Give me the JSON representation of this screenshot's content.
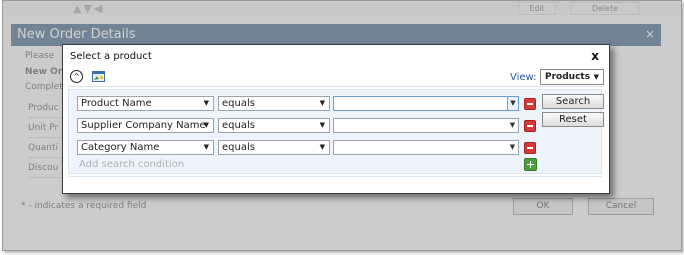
{
  "background": {
    "toolbar": {
      "edit_label": "Edit",
      "delete_label": "Delete"
    },
    "title": "New Order Details",
    "close_glyph": "×",
    "intro_text": "Please",
    "subheading": "New Or",
    "completed_text": "Complete",
    "fields": [
      "Produc",
      "Unit Pr",
      "Quanti",
      "Discou"
    ],
    "required_note": "* - indicates a required field",
    "ok_label": "OK",
    "cancel_label": "Cancel"
  },
  "dialog": {
    "title": "Select a product",
    "close_glyph": "x",
    "collapse_glyph": "^",
    "view_label": "View:",
    "view_value": "Products",
    "conditions": [
      {
        "field": "Product Name",
        "operator": "equals",
        "value": ""
      },
      {
        "field": "Supplier Company Name",
        "operator": "equals",
        "value": ""
      },
      {
        "field": "Category Name",
        "operator": "equals",
        "value": ""
      }
    ],
    "add_condition_label": "Add search condition",
    "search_label": "Search",
    "reset_label": "Reset"
  },
  "colors": {
    "header_bg": "#5e7c9c",
    "filter_bg": "#eef4fb",
    "remove_red": "#d33b3b",
    "add_green": "#4f9e3c",
    "view_label": "#2a5a9a"
  },
  "icons": [
    "collapse-icon",
    "image-icon",
    "remove-icon",
    "add-icon",
    "dropdown-arrow-icon"
  ]
}
